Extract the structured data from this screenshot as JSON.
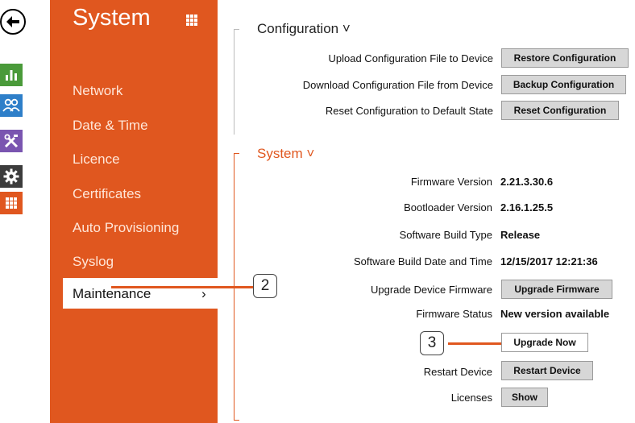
{
  "rail": {
    "icons": [
      "back-arrow-icon",
      "chart-icon",
      "users-icon",
      "tools-icon",
      "gear-icon",
      "apps-grid-icon"
    ],
    "colors": {
      "chart": "#4a9a3a",
      "users": "#2e7fc9",
      "tools": "#7a55b0",
      "gear": "#3c3c3c",
      "apps": "#e0571f"
    }
  },
  "sidebar": {
    "title": "System",
    "items": [
      {
        "label": "Network"
      },
      {
        "label": "Date & Time"
      },
      {
        "label": "Licence"
      },
      {
        "label": "Certificates"
      },
      {
        "label": "Auto Provisioning"
      },
      {
        "label": "Syslog"
      },
      {
        "label": "Maintenance",
        "chevron": "›"
      }
    ],
    "accent": "#e0571f"
  },
  "configuration": {
    "title": "Configuration ˅",
    "rows": [
      {
        "label": "Upload Configuration File to Device",
        "button": "Restore Configuration"
      },
      {
        "label": "Download Configuration File from Device",
        "button": "Backup Configuration"
      },
      {
        "label": "Reset Configuration to Default State",
        "button": "Reset Configuration"
      }
    ]
  },
  "system": {
    "title": "System ˅",
    "firmware_version_label": "Firmware Version",
    "firmware_version": "2.21.3.30.6",
    "bootloader_version_label": "Bootloader Version",
    "bootloader_version": "2.16.1.25.5",
    "build_type_label": "Software Build Type",
    "build_type": "Release",
    "build_date_label": "Software Build Date and Time",
    "build_date": "12/15/2017 12:21:36",
    "upgrade_label": "Upgrade Device Firmware",
    "upgrade_button": "Upgrade Firmware",
    "firmware_status_label": "Firmware Status",
    "firmware_status": "New version available",
    "upgrade_now_button": "Upgrade Now",
    "restart_label": "Restart Device",
    "restart_button": "Restart Device",
    "licenses_label": "Licenses",
    "licenses_button": "Show"
  },
  "callouts": {
    "one": "2",
    "two": "3"
  }
}
